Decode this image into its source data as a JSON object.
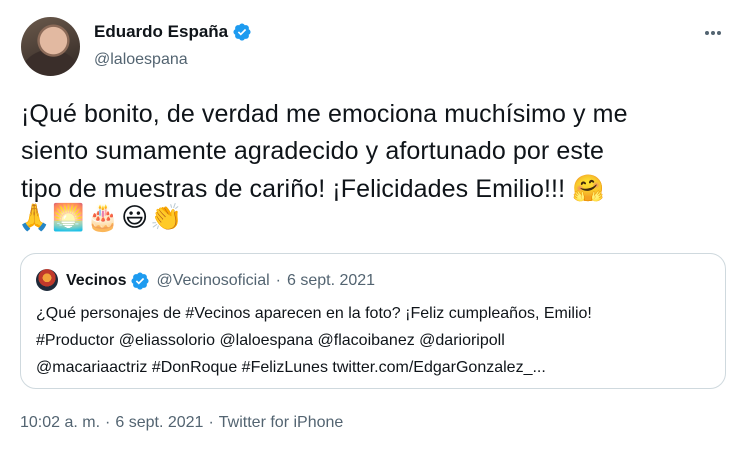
{
  "author": {
    "name": "Eduardo España",
    "handle": "@laloespana"
  },
  "tweet": {
    "text_line1": "¡Qué bonito, de verdad me emociona muchísimo y me",
    "text_line2": "siento sumamente agradecido y afortunado por este",
    "text_line3": "tipo de muestras de cariño! ¡Felicidades Emilio!!!",
    "emoji_hug": "🤗",
    "emojis": [
      "🙏",
      "🌅",
      "🎂",
      "😃",
      "👏"
    ]
  },
  "quote": {
    "name": "Vecinos",
    "handle": "@Vecinosoficial",
    "separator": "·",
    "date": "6 sept. 2021",
    "line1": "¿Qué personajes de #Vecinos aparecen en la foto? ¡Feliz cumpleaños, Emilio!",
    "line2": "#Productor  @eliassolorio @laloespana @flacoibanez @darioripoll",
    "line3": "@macariaactriz #DonRoque #FelizLunes twitter.com/EdgarGonzalez_..."
  },
  "footer": {
    "time": "10:02 a. m.",
    "sep1": "·",
    "date": "6 sept. 2021",
    "sep2": "·",
    "source": "Twitter for iPhone"
  },
  "icons": {
    "verified": "verified-badge-icon",
    "more": "more-horizontal-icon"
  },
  "colors": {
    "verified_blue": "#1d9bf0",
    "secondary_text": "#536471",
    "border": "#cfd9de"
  }
}
